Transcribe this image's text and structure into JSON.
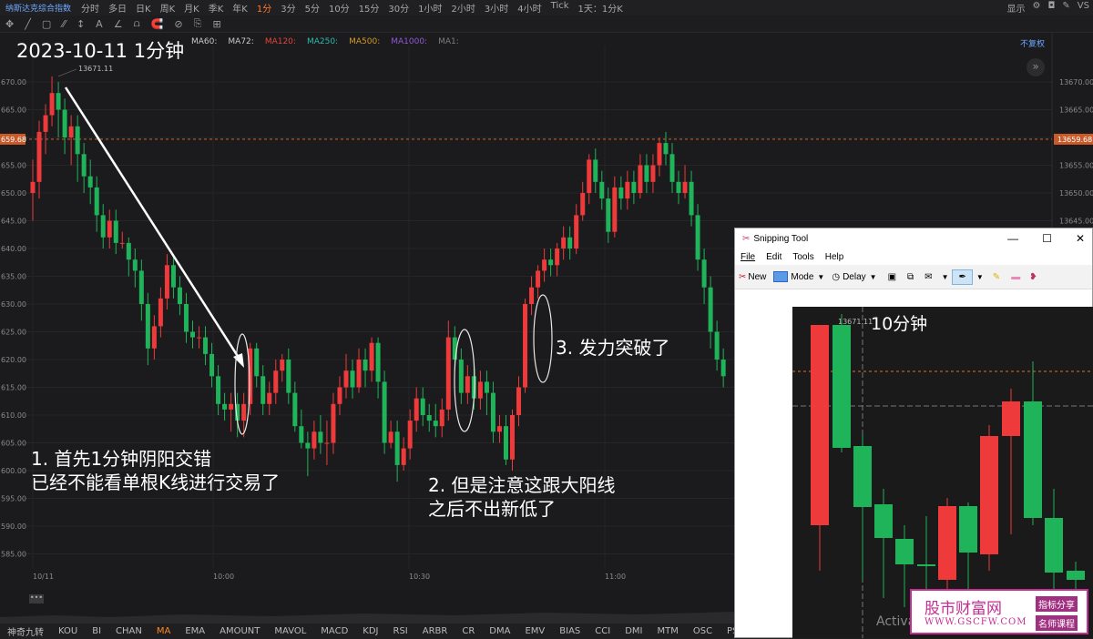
{
  "app": {
    "symbol": "纳斯达克综合指数",
    "timeframes": [
      "分时",
      "多日",
      "日K",
      "周K",
      "月K",
      "季K",
      "年K",
      "1分",
      "3分",
      "5分",
      "10分",
      "15分",
      "30分",
      "1小时",
      "2小时",
      "3小时",
      "4小时",
      "Tick"
    ],
    "active_timeframe": "1分",
    "period_select": "1天：1分K",
    "right_menu": [
      "显示",
      "VS"
    ]
  },
  "toolbar": {
    "items": [
      "✥",
      "╱",
      "▢",
      "⁄⁄",
      "↕",
      "A",
      "∠",
      "⩍",
      "🧲",
      "⊘",
      "⎘",
      "⊞"
    ],
    "ma_legend": [
      {
        "label": "MA60:",
        "color": "#c9c9c9"
      },
      {
        "label": "MA72:",
        "color": "#c9c9c9"
      },
      {
        "label": "MA120:",
        "color": "#e0453a"
      },
      {
        "label": "MA250:",
        "color": "#2fb9a8"
      },
      {
        "label": "MA500:",
        "color": "#d39a25"
      },
      {
        "label": "MA1000:",
        "color": "#8e5ad6"
      },
      {
        "label": "MA1:",
        "color": "#7c7c7c"
      }
    ],
    "restore_label": "不复权"
  },
  "chart": {
    "title": "2023-10-11 1分钟",
    "high_label": "13671.11",
    "current_price_left": "659.68",
    "current_price_right": "13659.68",
    "left_ticks": [
      "670.00",
      "665.00",
      "660.00",
      "655.00",
      "650.00",
      "645.00",
      "640.00",
      "635.00",
      "630.00",
      "625.00",
      "620.00",
      "615.00",
      "610.00",
      "605.00",
      "600.00",
      "595.00",
      "590.00",
      "585.00"
    ],
    "right_ticks": [
      "13670.00",
      "13665.00",
      "",
      "13655.00",
      "13650.00",
      "13645.00"
    ],
    "time_labels": [
      "10/11",
      "10:00",
      "10:30",
      "11:00"
    ],
    "annotation1": [
      "1. 首先1分钟阴阳交错",
      "已经不能看单根K线进行交易了"
    ],
    "annotation2": [
      "2. 但是注意这跟大阳线",
      "之后不出新低了"
    ],
    "annotation3": "3. 发力突破了",
    "colors": {
      "up": "#ee3a3a",
      "down": "#1fb35a",
      "price_line": "#e0722c"
    }
  },
  "indicators": [
    "神奇九转",
    "KOU",
    "BI",
    "CHAN",
    "MA",
    "EMA",
    "AMOUNT",
    "MAVOL",
    "MACD",
    "KDJ",
    "RSI",
    "ARBR",
    "CR",
    "DMA",
    "EMV",
    "BIAS",
    "CCI",
    "DMI",
    "MTM",
    "OSC",
    "PSY",
    "VR",
    "WMSR",
    "指"
  ],
  "active_indicator": "MA",
  "snipping_tool": {
    "title": "Snipping Tool",
    "menu": [
      "File",
      "Edit",
      "Tools",
      "Help"
    ],
    "buttons": {
      "new": "New",
      "mode": "Mode",
      "delay": "Delay"
    },
    "inner_title": "10分钟",
    "inner_high": "13671.11",
    "activate_text": "Activa",
    "watermark_main": "股市财富网",
    "watermark_url": "WWW.GSCFW.COM",
    "watermark_tag1": "指标分享",
    "watermark_tag2": "名师课程"
  },
  "chart_data": {
    "type": "candlestick",
    "title": "2023-10-11 1分钟",
    "y_axis_display_range": [
      582,
      673
    ],
    "candles": [
      [
        650,
        652,
        656,
        645
      ],
      [
        652,
        661,
        663,
        649
      ],
      [
        661,
        664,
        666,
        657
      ],
      [
        664,
        668,
        671,
        662
      ],
      [
        668,
        665,
        670,
        660
      ],
      [
        665,
        660,
        667,
        657
      ],
      [
        660,
        662,
        664,
        655
      ],
      [
        662,
        657,
        664,
        652
      ],
      [
        657,
        653,
        659,
        650
      ],
      [
        653,
        651,
        656,
        648
      ],
      [
        651,
        646,
        653,
        643
      ],
      [
        646,
        642,
        648,
        640
      ],
      [
        642,
        645,
        647,
        640
      ],
      [
        645,
        641,
        647,
        639
      ],
      [
        641,
        641,
        643,
        640
      ],
      [
        641,
        638,
        642,
        635
      ],
      [
        638,
        636,
        640,
        633
      ],
      [
        636,
        630,
        638,
        627
      ],
      [
        630,
        622,
        632,
        619
      ],
      [
        622,
        626,
        628,
        620
      ],
      [
        626,
        631,
        633,
        624
      ],
      [
        631,
        637,
        639,
        629
      ],
      [
        637,
        633,
        639,
        631
      ],
      [
        633,
        630,
        635,
        628
      ],
      [
        630,
        625,
        632,
        623
      ],
      [
        625,
        624,
        627,
        622
      ],
      [
        624,
        624,
        626,
        622
      ],
      [
        624,
        621,
        626,
        619
      ],
      [
        621,
        617,
        623,
        615
      ],
      [
        617,
        612,
        619,
        610
      ],
      [
        612,
        611,
        614,
        609
      ],
      [
        611,
        612,
        614,
        607
      ],
      [
        612,
        609,
        614,
        606
      ],
      [
        609,
        612,
        614,
        606
      ],
      [
        612,
        622,
        623,
        610
      ],
      [
        622,
        617,
        623,
        615
      ],
      [
        617,
        612,
        619,
        610
      ],
      [
        612,
        614,
        616,
        610
      ],
      [
        614,
        618,
        620,
        612
      ],
      [
        618,
        620,
        621,
        616
      ],
      [
        620,
        614,
        622,
        612
      ],
      [
        614,
        608,
        616,
        607
      ],
      [
        608,
        605,
        611,
        604
      ],
      [
        605,
        604,
        607,
        599
      ],
      [
        604,
        607,
        609,
        602
      ],
      [
        607,
        605,
        610,
        603
      ],
      [
        605,
        605,
        609,
        601
      ],
      [
        605,
        612,
        614,
        603
      ],
      [
        612,
        615,
        617,
        610
      ],
      [
        615,
        618,
        621,
        613
      ],
      [
        618,
        615,
        620,
        613
      ],
      [
        615,
        620,
        622,
        614
      ],
      [
        620,
        618,
        622,
        615
      ],
      [
        618,
        623,
        624,
        616
      ],
      [
        623,
        616,
        624,
        613
      ],
      [
        616,
        605,
        618,
        603
      ],
      [
        605,
        607,
        609,
        604
      ],
      [
        607,
        601,
        609,
        598
      ],
      [
        601,
        604,
        606,
        600
      ],
      [
        604,
        609,
        611,
        602
      ],
      [
        609,
        613,
        615,
        607
      ],
      [
        613,
        610,
        615,
        608
      ],
      [
        610,
        609,
        612,
        607
      ],
      [
        609,
        608,
        612,
        606
      ],
      [
        608,
        611,
        613,
        606
      ],
      [
        611,
        624,
        627,
        609
      ],
      [
        624,
        620,
        626,
        618
      ],
      [
        620,
        614,
        622,
        612
      ],
      [
        614,
        617,
        619,
        612
      ],
      [
        617,
        613,
        619,
        611
      ],
      [
        613,
        616,
        618,
        611
      ],
      [
        616,
        614,
        618,
        610
      ],
      [
        614,
        607,
        616,
        605
      ],
      [
        607,
        608,
        610,
        605
      ],
      [
        608,
        602,
        610,
        601
      ],
      [
        602,
        610,
        611,
        600
      ],
      [
        610,
        615,
        617,
        608
      ],
      [
        615,
        630,
        631,
        614
      ],
      [
        630,
        633,
        635,
        628
      ],
      [
        633,
        636,
        637,
        631
      ],
      [
        636,
        638,
        640,
        634
      ],
      [
        638,
        637,
        640,
        635
      ],
      [
        637,
        640,
        641,
        635
      ],
      [
        640,
        642,
        644,
        638
      ],
      [
        642,
        640,
        644,
        638
      ],
      [
        640,
        646,
        648,
        639
      ],
      [
        646,
        650,
        652,
        645
      ],
      [
        650,
        656,
        657,
        648
      ],
      [
        656,
        652,
        658,
        650
      ],
      [
        652,
        649,
        654,
        647
      ],
      [
        649,
        643,
        651,
        641
      ],
      [
        643,
        651,
        653,
        642
      ],
      [
        651,
        649,
        653,
        647
      ],
      [
        649,
        652,
        654,
        647
      ],
      [
        652,
        650,
        654,
        648
      ],
      [
        650,
        655,
        657,
        649
      ],
      [
        655,
        652,
        657,
        650
      ],
      [
        652,
        655,
        657,
        650
      ],
      [
        655,
        659,
        660,
        653
      ],
      [
        659,
        657,
        661,
        655
      ],
      [
        657,
        652,
        659,
        650
      ],
      [
        652,
        650,
        654,
        648
      ],
      [
        650,
        652,
        655,
        649
      ],
      [
        652,
        646,
        654,
        644
      ],
      [
        646,
        638,
        648,
        636
      ],
      [
        638,
        633,
        640,
        630
      ],
      [
        633,
        625,
        635,
        622
      ],
      [
        625,
        620,
        627,
        618
      ],
      [
        620,
        617,
        622,
        615
      ]
    ]
  }
}
